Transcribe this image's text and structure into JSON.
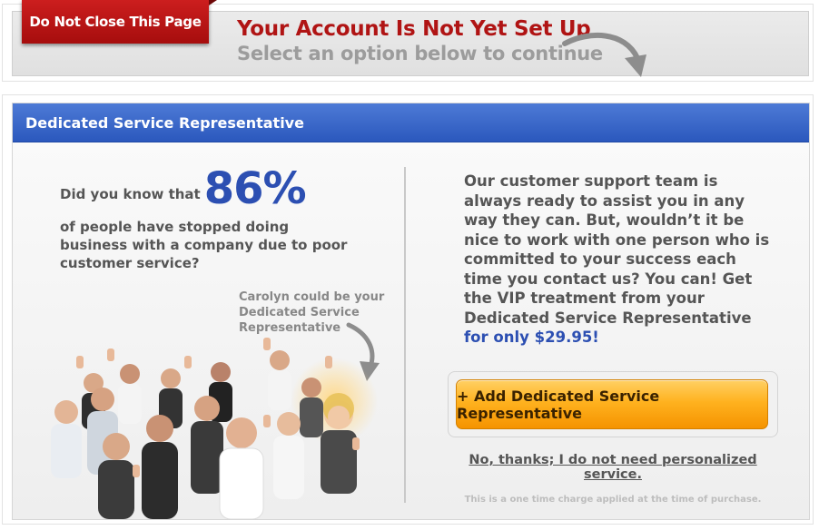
{
  "ribbon": {
    "label": "Do Not Close This Page"
  },
  "top": {
    "title": "Your Account Is Not Yet Set Up",
    "subtitle": "Select an option below to continue"
  },
  "panel": {
    "header": "Dedicated Service Representative",
    "stat_prefix": "Did you know that",
    "stat_value": "86%",
    "stat_desc": "of people have stopped doing business with a company due to poor customer service?",
    "carolyn_note": "Carolyn could be your Dedicated Service Representative",
    "pitch": "Our customer support team is always ready to assist you in any way they can.  But, wouldn’t it be nice to work with one person who is committed to your success each time you contact us?  You can!  Get the VIP treatment from your Dedicated Service Representative",
    "price": "for only $29.95!",
    "cta_label": "+ Add Dedicated Service Representative",
    "decline_label": "No, thanks; I do not need personalized service.",
    "fineprint": "This is a one time charge applied at the time of purchase."
  },
  "colors": {
    "ribbon_red": "#b51616",
    "title_red": "#b01414",
    "header_blue": "#3a66c8",
    "stat_blue": "#2c4fb2",
    "cta_orange": "#ffb21f"
  },
  "icons": [
    "curved-arrow-icon",
    "curved-arrow-small-icon"
  ]
}
